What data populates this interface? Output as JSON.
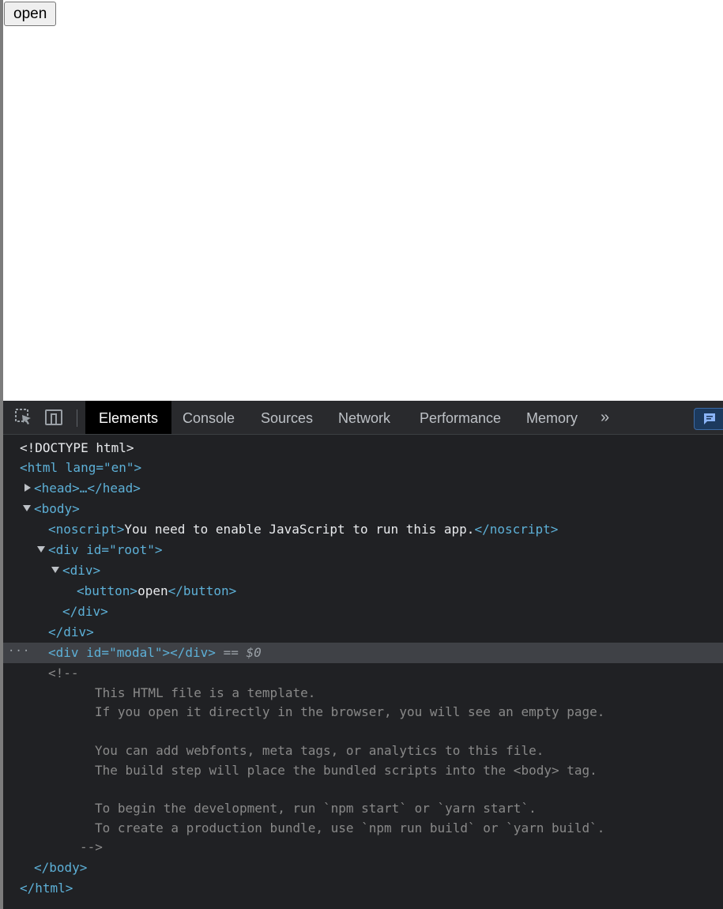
{
  "page": {
    "button_label": "open"
  },
  "devtools": {
    "tabs": [
      "Elements",
      "Console",
      "Sources",
      "Network",
      "Performance",
      "Memory"
    ],
    "more_label": "»",
    "selected_suffix": "== $0"
  },
  "tree": {
    "l1": "<!DOCTYPE html>",
    "html_open": "<html lang=\"en\">",
    "head": "<head>…</head>",
    "body_open": "<body>",
    "noscript_open": "<noscript>",
    "noscript_text": "You need to enable JavaScript to run this app.",
    "noscript_close": "</noscript>",
    "div_root_open": "<div id=\"root\">",
    "div_open": "<div>",
    "button_open": "<button>",
    "button_text": "open",
    "button_close": "</button>",
    "div_close_inner": "</div>",
    "div_close_root": "</div>",
    "modal_open": "<div id=\"modal\">",
    "modal_close": "</div>",
    "comment_open": "<!--",
    "comment_lines": [
      "This HTML file is a template.",
      "If you open it directly in the browser, you will see an empty page.",
      "",
      "You can add webfonts, meta tags, or analytics to this file.",
      "The build step will place the bundled scripts into the <body> tag.",
      "",
      "To begin the development, run `npm start` or `yarn start`.",
      "To create a production bundle, use `npm run build` or `yarn build`."
    ],
    "comment_close": "-->",
    "body_close": "</body>",
    "html_close": "</html>"
  }
}
